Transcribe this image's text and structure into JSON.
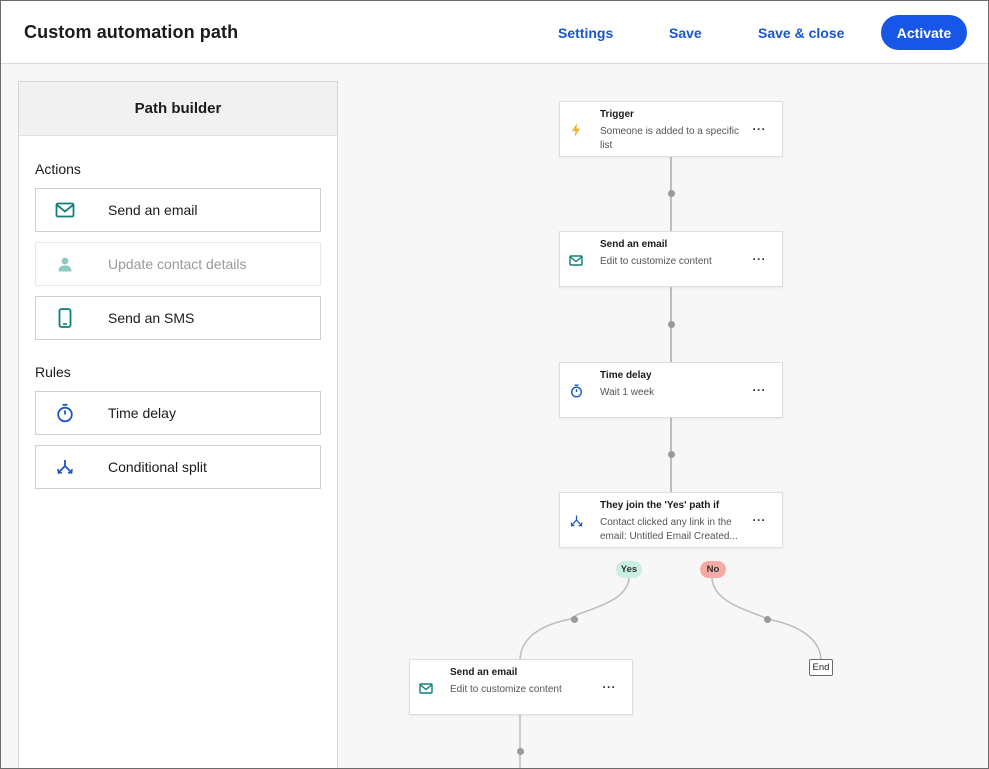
{
  "header": {
    "title": "Custom automation path",
    "links": {
      "settings": "Settings",
      "save": "Save",
      "save_close": "Save & close"
    },
    "activate_label": "Activate"
  },
  "panel": {
    "title": "Path builder",
    "actions_title": "Actions",
    "actions": [
      {
        "label": "Send an email",
        "icon": "envelope-icon",
        "enabled": true
      },
      {
        "label": "Update contact details",
        "icon": "person-icon",
        "enabled": false
      },
      {
        "label": "Send an SMS",
        "icon": "phone-icon",
        "enabled": true
      }
    ],
    "rules_title": "Rules",
    "rules": [
      {
        "label": "Time delay",
        "icon": "stopwatch-icon"
      },
      {
        "label": "Conditional split",
        "icon": "split-icon"
      }
    ]
  },
  "flow": {
    "trigger": {
      "title": "Trigger",
      "subtitle": "Someone is added to a specific list",
      "menu": "···"
    },
    "email1": {
      "title": "Send an email",
      "subtitle": "Edit to customize content",
      "menu": "···"
    },
    "delay": {
      "title": "Time delay",
      "subtitle": "Wait 1 week",
      "menu": "···"
    },
    "split": {
      "title": "They join the 'Yes' path if",
      "subtitle": "Contact clicked any link in the email: Untitled Email Created...",
      "menu": "···"
    },
    "yes_label": "Yes",
    "no_label": "No",
    "end_label": "End",
    "email2": {
      "title": "Send an email",
      "subtitle": "Edit to customize content",
      "menu": "···"
    }
  },
  "colors": {
    "accent": "#1856e8",
    "link": "#1856c9",
    "icon_teal": "#0f7f7a",
    "trigger_icon": "#f2b233",
    "yes_pill": "#c8efdf",
    "no_pill": "#f6aaa5"
  }
}
